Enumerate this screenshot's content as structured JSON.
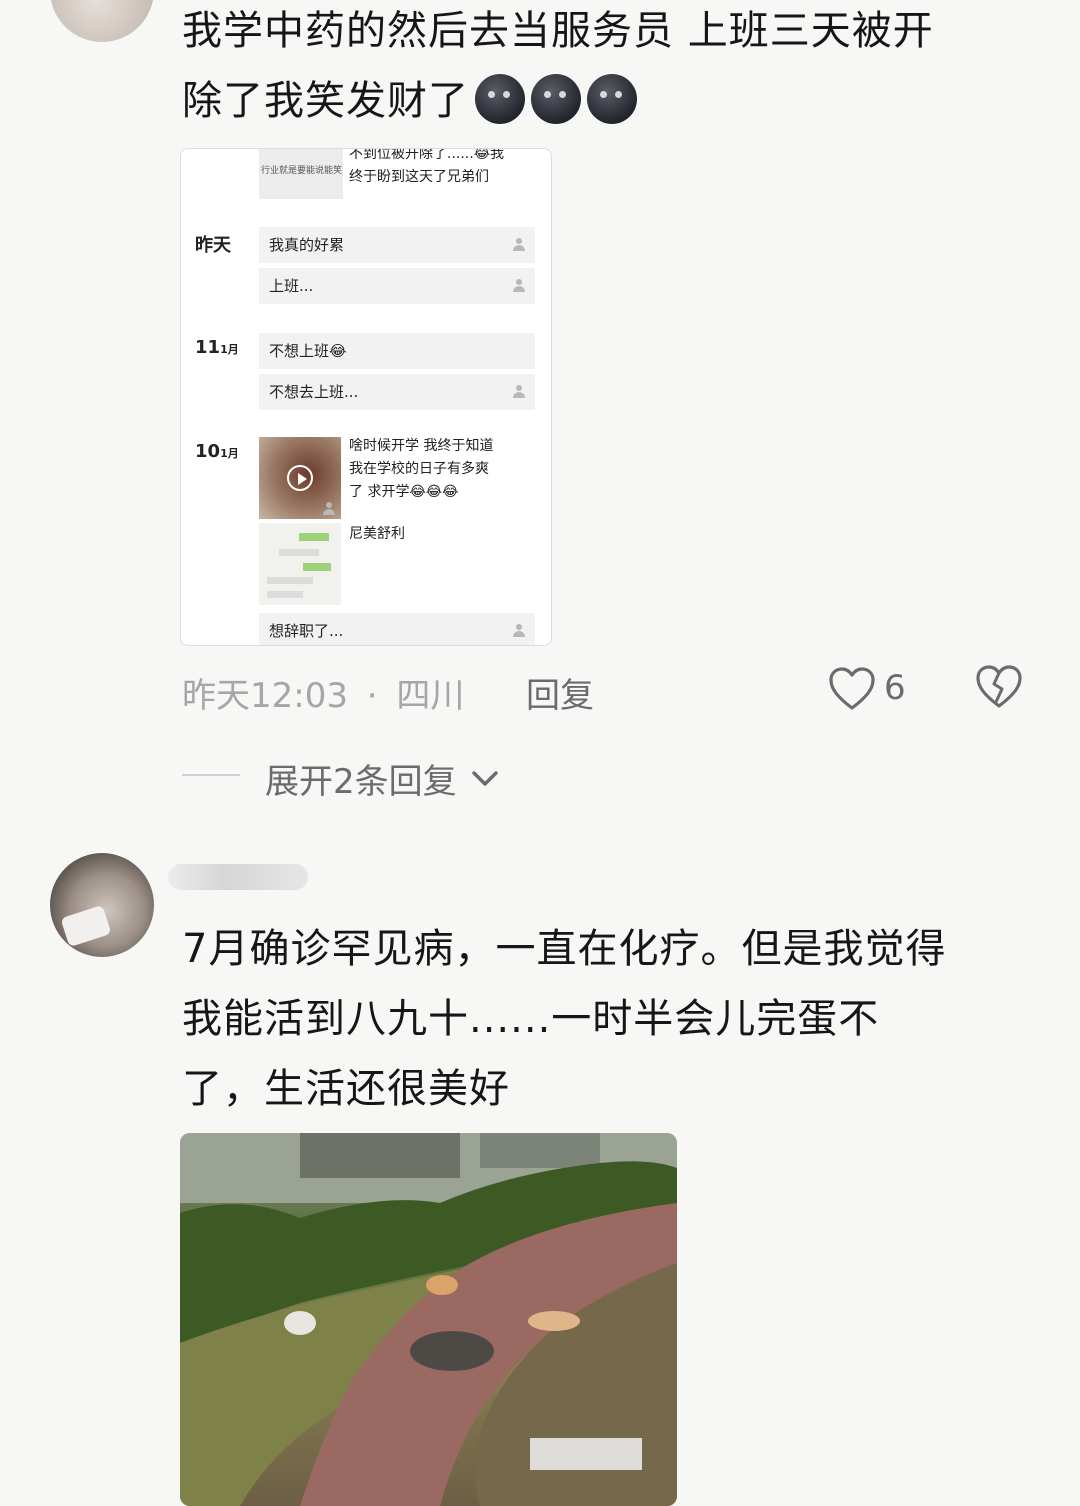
{
  "comment1": {
    "text_line1": "我学中药的然后去当服务员 上班三天被开",
    "text_line2": "除了我笑发财了",
    "emoji_icons": [
      "dark-moon-face-icon",
      "dark-moon-face-icon",
      "dark-moon-face-icon"
    ],
    "screenshot": {
      "top_snippet_line1": "不到位被开除了......😂我",
      "top_snippet_line2": "终于盼到这天了兄弟们",
      "thumb_caption": "行业就是要能说能笑",
      "groups": [
        {
          "date_main": "昨天",
          "date_small": "",
          "posts": [
            "我真的好累",
            "上班..."
          ]
        },
        {
          "date_main": "11",
          "date_small": "1月",
          "posts": [
            "不想上班😂",
            "不想去上班..."
          ]
        },
        {
          "date_main": "10",
          "date_small": "1月",
          "posts": [
            "啥时候开学 我终于知道",
            "我在学校的日子有多爽",
            "了 求开学😂😂😂",
            "尼美舒利",
            "想辞职了..."
          ]
        }
      ]
    },
    "meta_time": "昨天12:03",
    "meta_sep": "·",
    "meta_location": "四川",
    "reply_label": "回复",
    "like_count": "6",
    "expand_label": "展开2条回复"
  },
  "comment2": {
    "text_line1": "7月确诊罕见病，一直在化疗。但是我觉得",
    "text_line2": "我能活到八九十......一时半会儿完蛋不",
    "text_line3": "了，生活还很美好"
  },
  "colors": {
    "background": "#f7f7f5",
    "text": "#161616",
    "meta": "#a6a6a6",
    "action": "#6b6b6b"
  }
}
